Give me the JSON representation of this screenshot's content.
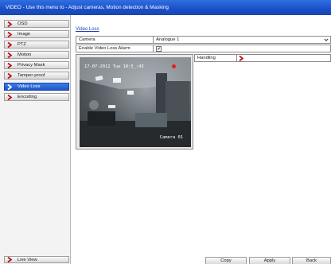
{
  "window": {
    "title": "VIDEO - Use this menu to - Adjust cameras, Motion detection & Masking"
  },
  "sidebar": {
    "items": [
      {
        "label": "OSD",
        "active": false
      },
      {
        "label": "Image",
        "active": false
      },
      {
        "label": "PTZ",
        "active": false
      },
      {
        "label": "Motion",
        "active": false
      },
      {
        "label": "Privacy Mask",
        "active": false
      },
      {
        "label": "Tamper-proof",
        "active": false
      },
      {
        "label": "Video Loss",
        "active": true
      },
      {
        "label": "Encoding",
        "active": false
      }
    ],
    "live_view_label": "Live View"
  },
  "main": {
    "section_title": "Video Loss",
    "camera_label": "Camera",
    "camera_value": "Analogue 1",
    "enable_label": "Enable Video Loss Alarm",
    "enable_checked": true,
    "handling_label": "Handling",
    "preview": {
      "timestamp": "17-07-2012 Tue 10:5_:43",
      "camera_name": "Camera 01"
    }
  },
  "buttons": {
    "copy": "Copy",
    "apply": "Apply",
    "back": "Back"
  },
  "colors": {
    "title_bar": "#1a4fc8",
    "active_item": "#1d55cc",
    "chevron": "#c0141c",
    "link": "#1f3fb0"
  },
  "icons": {
    "menu_chevron": "chevron-right-icon",
    "dropdown": "chevron-down-icon",
    "check": "check-icon",
    "record": "record-dot-icon"
  }
}
